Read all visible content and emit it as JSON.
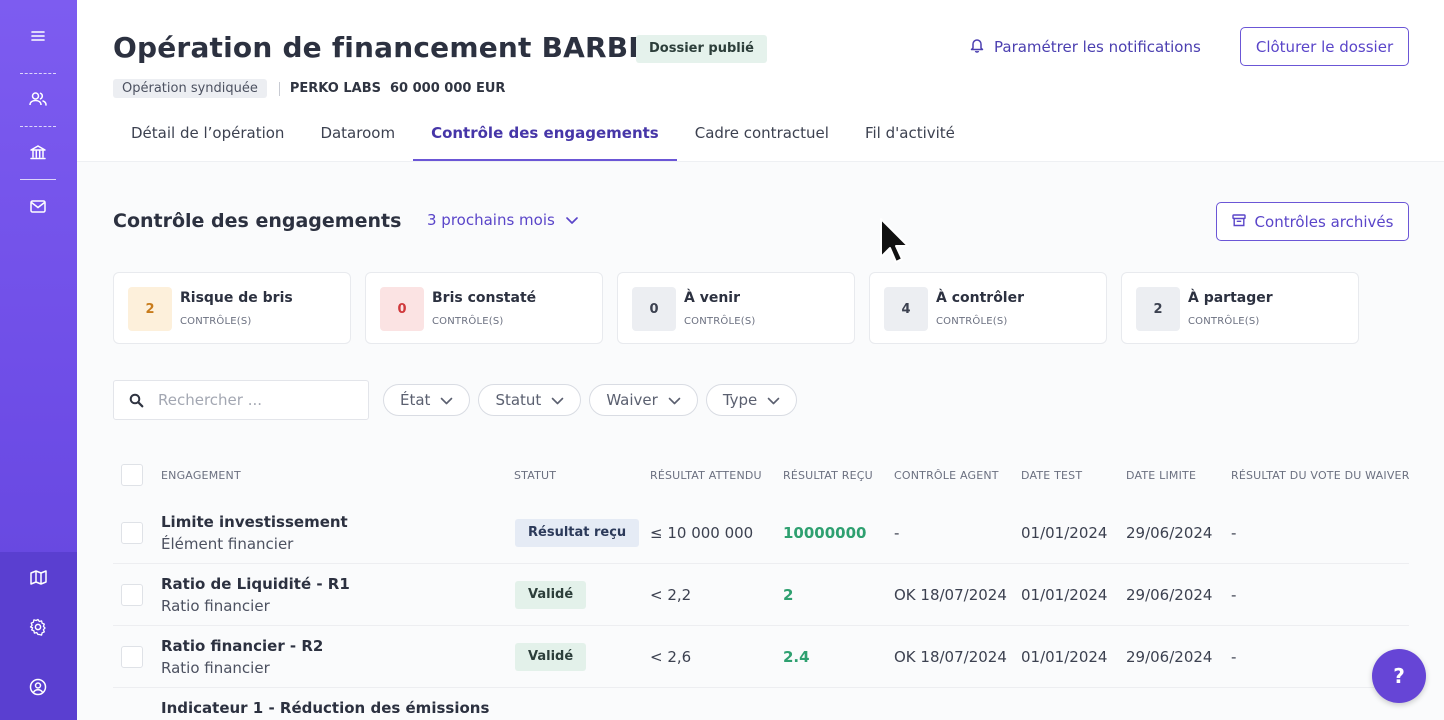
{
  "header": {
    "title": "Opération de financement BARBERA",
    "published_badge": "Dossier publié",
    "notifications_label": "Paramétrer les notifications",
    "close_button": "Clôturer le dossier",
    "operation_type": "Opération syndiquée",
    "company": "PERKO LABS",
    "amount": "60 000 000 EUR"
  },
  "tabs": [
    {
      "label": "Détail de l’opération",
      "active": false
    },
    {
      "label": "Dataroom",
      "active": false
    },
    {
      "label": "Contrôle des engagements",
      "active": true
    },
    {
      "label": "Cadre contractuel",
      "active": false
    },
    {
      "label": "Fil d'activité",
      "active": false
    }
  ],
  "section": {
    "title": "Contrôle des engagements",
    "period": "3 prochains mois",
    "archived_button": "Contrôles archivés"
  },
  "cards": [
    {
      "count": "2",
      "label": "Risque de bris",
      "sub": "CONTRÔLE(S)",
      "bg": "#fdf0db",
      "fg": "#c87b1a"
    },
    {
      "count": "0",
      "label": "Bris constaté",
      "sub": "CONTRÔLE(S)",
      "bg": "#fbe3e3",
      "fg": "#d0393c"
    },
    {
      "count": "0",
      "label": "À venir",
      "sub": "CONTRÔLE(S)",
      "bg": "#eceef2",
      "fg": "#3c4150"
    },
    {
      "count": "4",
      "label": "À contrôler",
      "sub": "CONTRÔLE(S)",
      "bg": "#eceef2",
      "fg": "#3c4150"
    },
    {
      "count": "2",
      "label": "À partager",
      "sub": "CONTRÔLE(S)",
      "bg": "#eceef2",
      "fg": "#3c4150"
    }
  ],
  "search": {
    "placeholder": "Rechercher ..."
  },
  "filters": [
    "État",
    "Statut",
    "Waiver",
    "Type"
  ],
  "table": {
    "columns": [
      "ENGAGEMENT",
      "STATUT",
      "RÉSULTAT ATTENDU",
      "RÉSULTAT REÇU",
      "CONTRÔLE AGENT",
      "DATE TEST",
      "DATE LIMITE",
      "RÉSULTAT DU VOTE DU WAIVER"
    ],
    "rows": [
      {
        "name": "Limite investissement",
        "category": "Élément financier",
        "status": "Résultat reçu",
        "status_type": "blue",
        "expected": "≤ 10 000 000",
        "received": "10000000",
        "agent": "-",
        "date_test": "01/01/2024",
        "date_limit": "29/06/2024",
        "waiver": "-"
      },
      {
        "name": "Ratio de Liquidité - R1",
        "category": "Ratio financier",
        "status": "Validé",
        "status_type": "green",
        "expected": "< 2,2",
        "received": "2",
        "agent": "OK 18/07/2024",
        "date_test": "01/01/2024",
        "date_limit": "29/06/2024",
        "waiver": "-"
      },
      {
        "name": "Ratio financier - R2",
        "category": "Ratio financier",
        "status": "Validé",
        "status_type": "green",
        "expected": "< 2,6",
        "received": "2.4",
        "agent": "OK 18/07/2024",
        "date_test": "01/01/2024",
        "date_limit": "29/06/2024",
        "waiver": "-"
      },
      {
        "name": "Indicateur 1 - Réduction des émissions",
        "category": "",
        "status": "",
        "status_type": "",
        "expected": "",
        "received": "",
        "agent": "",
        "date_test": "",
        "date_limit": "",
        "waiver": ""
      }
    ]
  },
  "help_button": "?",
  "colors": {
    "accent": "#6b56d6",
    "sidebar": "#7d5cf0",
    "success": "#2ea070"
  }
}
